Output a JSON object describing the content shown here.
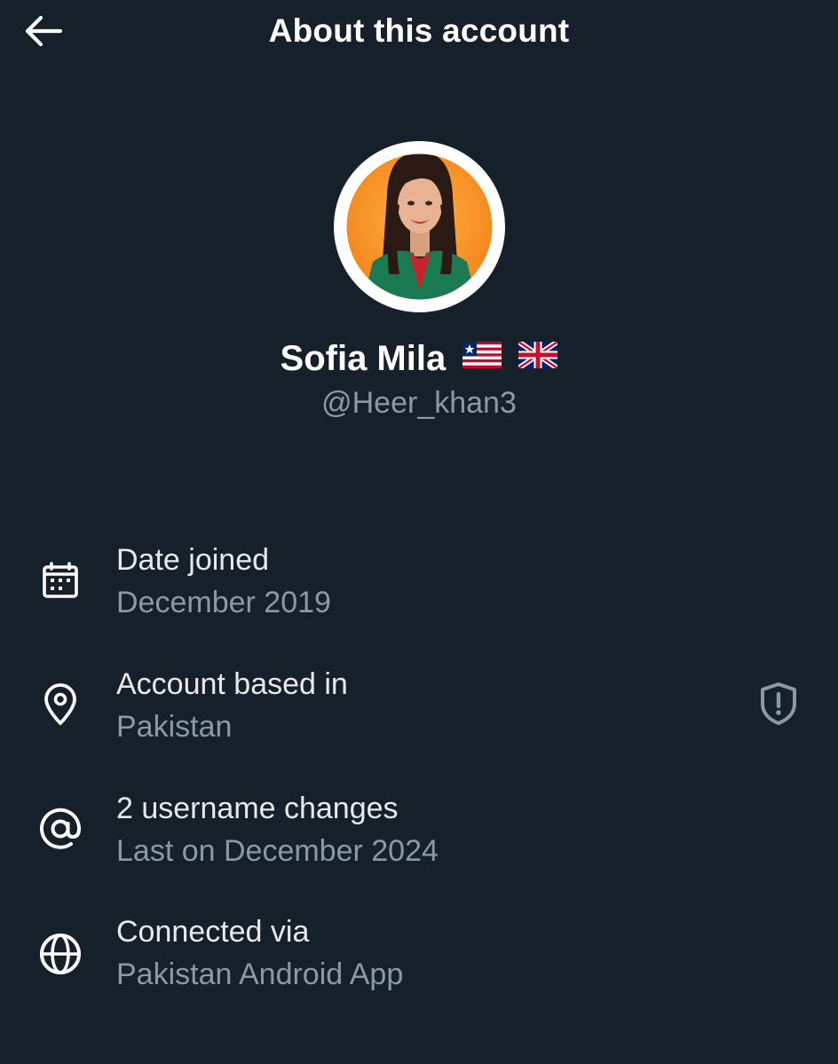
{
  "header": {
    "title": "About this account",
    "back_icon": "arrow-left-icon"
  },
  "profile": {
    "display_name": "Sofia Mila",
    "flags": [
      "liberia-flag-icon",
      "uk-flag-icon"
    ],
    "handle": "@Heer_khan3",
    "avatar_bg": "#f7941d"
  },
  "info": [
    {
      "icon": "calendar-icon",
      "label": "Date joined",
      "value": "December 2019"
    },
    {
      "icon": "location-pin-icon",
      "label": "Account based in",
      "value": "Pakistan",
      "action_icon": "shield-alert-icon"
    },
    {
      "icon": "at-sign-icon",
      "label": "2 username changes",
      "value": "Last on December 2024"
    },
    {
      "icon": "globe-icon",
      "label": "Connected via",
      "value": "Pakistan Android App"
    }
  ],
  "colors": {
    "background": "#15202b",
    "text_primary": "#e7e9ea",
    "text_secondary": "#8b98a5"
  }
}
